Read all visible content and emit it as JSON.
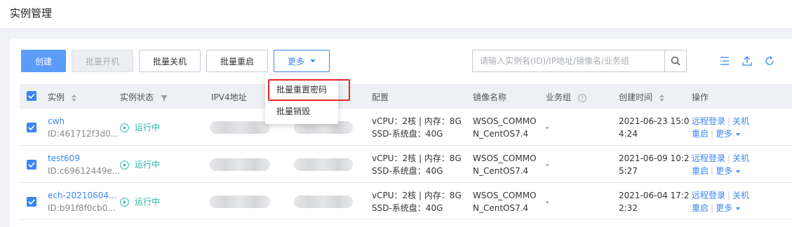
{
  "page": {
    "title": "实例管理"
  },
  "toolbar": {
    "create": "创建",
    "batch_start": "批量开机",
    "batch_stop": "批量关机",
    "batch_restart": "批量重启",
    "more": "更多",
    "search_placeholder": "请输入实例名(ID)/IP地址/镜像名/业务组"
  },
  "dropdown": {
    "items": [
      "批量重置密码",
      "批量销毁"
    ]
  },
  "columns": {
    "instance": "实例",
    "status": "实例状态",
    "ipv4": "IPV4地址",
    "config": "配置",
    "image": "镜像名称",
    "group": "业务组",
    "created": "创建时间",
    "actions": "操作"
  },
  "rows": [
    {
      "name": "cwh",
      "id": "ID:461712f3d0...",
      "status": "运行中",
      "config_line1": "vCPU：2核 | 内存：8G",
      "config_line2": "SSD-系统盘：40G",
      "image_line1": "WSOS_COMMO",
      "image_line2": "N_CentOS7.4",
      "group": "-",
      "created_line1": "2021-06-23 15:0",
      "created_line2": "4:24",
      "action_remote": "远程登录",
      "action_shutdown": "关机",
      "action_restart": "重启",
      "action_more": "更多"
    },
    {
      "name": "test609",
      "id": "ID:c69612449e...",
      "status": "运行中",
      "config_line1": "vCPU：2核 | 内存：8G",
      "config_line2": "SSD-系统盘：40G",
      "image_line1": "WSOS_COMMO",
      "image_line2": "N_CentOS7.4",
      "group": "-",
      "created_line1": "2021-06-09 10:2",
      "created_line2": "5:27",
      "action_remote": "远程登录",
      "action_shutdown": "关机",
      "action_restart": "重启",
      "action_more": "更多"
    },
    {
      "name": "ech-20210604...",
      "id": "ID:b91f8f0cb0...",
      "status": "运行中",
      "config_line1": "vCPU：2核 | 内存：8G",
      "config_line2": "SSD-系统盘：40G",
      "image_line1": "WSOS_COMMO",
      "image_line2": "N_CentOS7.4",
      "group": "-",
      "created_line1": "2021-06-04 17:2",
      "created_line2": "2:32",
      "action_remote": "远程登录",
      "action_shutdown": "关机",
      "action_restart": "重启",
      "action_more": "更多"
    }
  ],
  "icons": {
    "search": "search-icon",
    "list": "list-settings-icon",
    "export": "upload-icon",
    "refresh": "refresh-icon",
    "sort": "sort-icon",
    "filter": "filter-icon",
    "help": "help-circle-icon",
    "status": "play-circle-icon",
    "check": "checkmark-icon"
  },
  "colors": {
    "primary": "#3b86f5",
    "primary_button": "#5a9cf8",
    "running": "#2bb9a5",
    "highlight": "#e8252a"
  }
}
